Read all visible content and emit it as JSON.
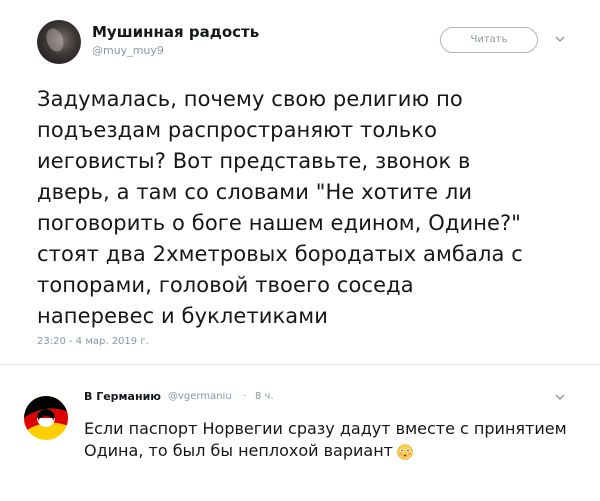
{
  "tweet": {
    "display_name": "Мушинная радость",
    "handle": "@muy_muy9",
    "follow_label": "Читать",
    "text": "Задумалась, почему свою религию по\nподъездам распространяют только\nиеговисты? Вот представьте, звонок в\nдверь, а там со словами \"Не хотите ли\nпоговорить о боге нашем едином, Одине?\"\nстоят два 2хметровых бородатых амбала с\nтопорами, головой твоего соседа\nнаперевес и буклетиками",
    "timestamp": "23:20 - 4 мар. 2019 г.",
    "avatar_icon": "user-photo-avatar"
  },
  "reply": {
    "display_name": "В Германию",
    "handle": "@vgermaniu",
    "separator": "·",
    "time": "8 ч.",
    "text": "Если паспорт Норвегии сразу дадут вместе с принятием\nОдина, то был бы неплохой вариант",
    "avatar_icon": "germany-flag-swirl-avatar",
    "emoji_icon": "flushed-face-emoji"
  },
  "colors": {
    "text": "#14171a",
    "muted": "#8899a6",
    "border": "#e6ecf0",
    "flag_black": "#000000",
    "flag_red": "#dd0000",
    "flag_gold": "#ffce00"
  }
}
